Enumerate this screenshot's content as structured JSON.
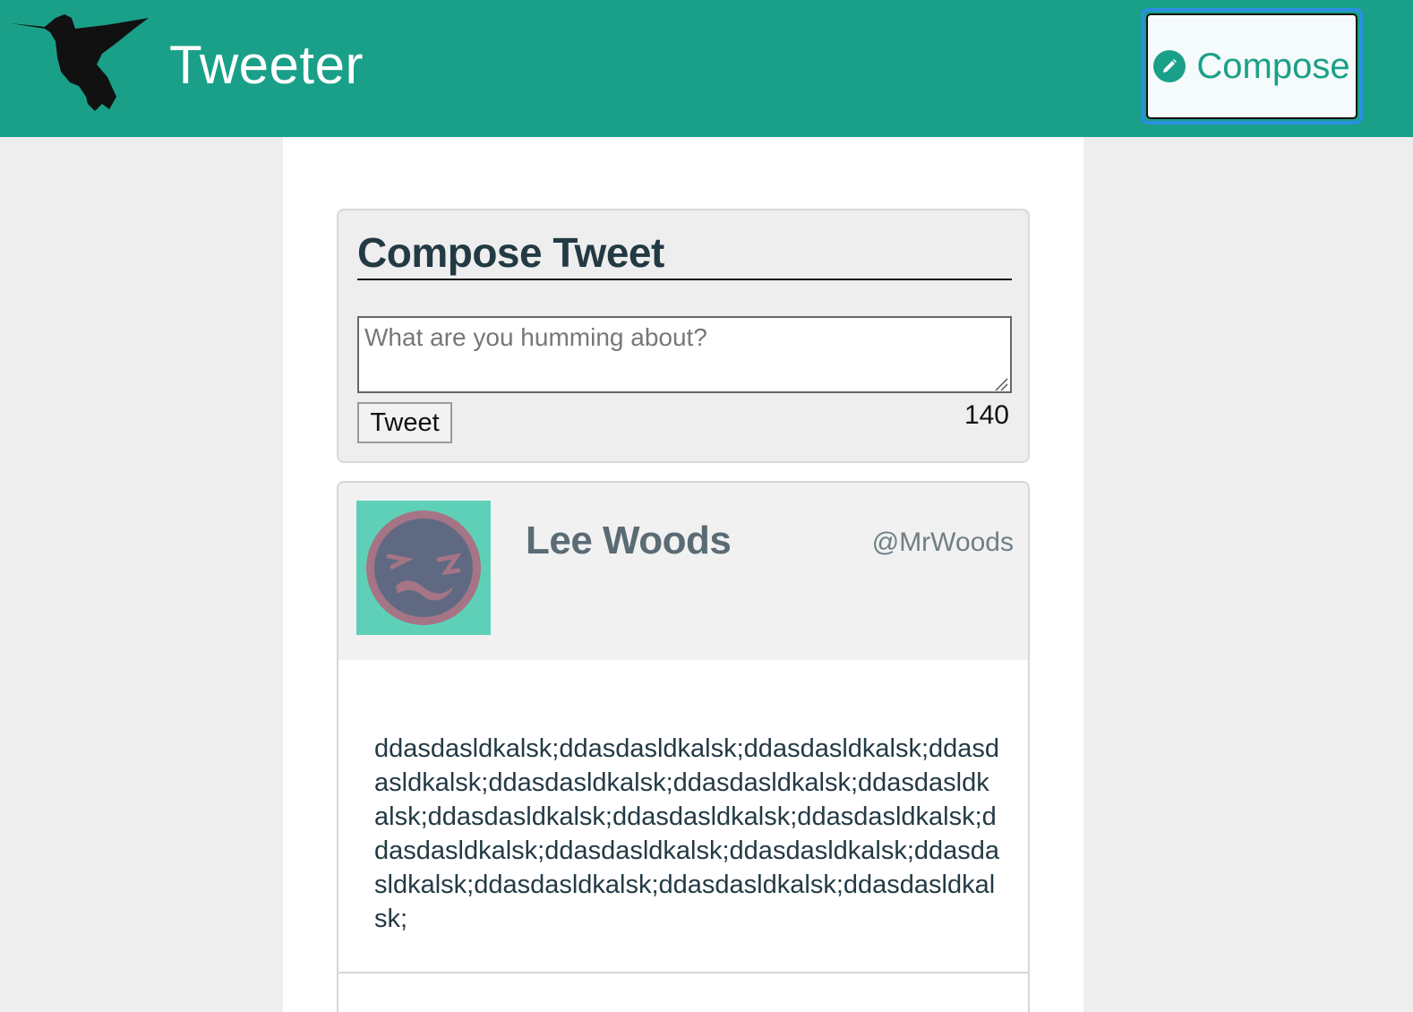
{
  "header": {
    "brand": "Tweeter",
    "compose_label": "Compose",
    "logo_icon": "hummingbird-icon",
    "compose_icon": "pencil-icon",
    "brand_color": "#1aa088"
  },
  "compose": {
    "title": "Compose Tweet",
    "placeholder": "What are you humming about?",
    "submit_label": "Tweet",
    "counter": "140"
  },
  "tweets": [
    {
      "name": "Lee Woods",
      "handle": "@MrWoods",
      "avatar_icon": "mustache-avatar-icon",
      "text": "ddasdasldkalsk;ddasdasldkalsk;ddasdasldkalsk;ddasdasldkalsk;ddasdasldkalsk;ddasdasldkalsk;ddasdasldkalsk;ddasdasldkalsk;ddasdasldkalsk;ddasdasldkalsk;ddasdasldkalsk;ddasdasldkalsk;ddasdasldkalsk;ddasdasldkalsk;ddasdasldkalsk;ddasdasldkalsk;ddasdasldkalsk;"
    }
  ]
}
